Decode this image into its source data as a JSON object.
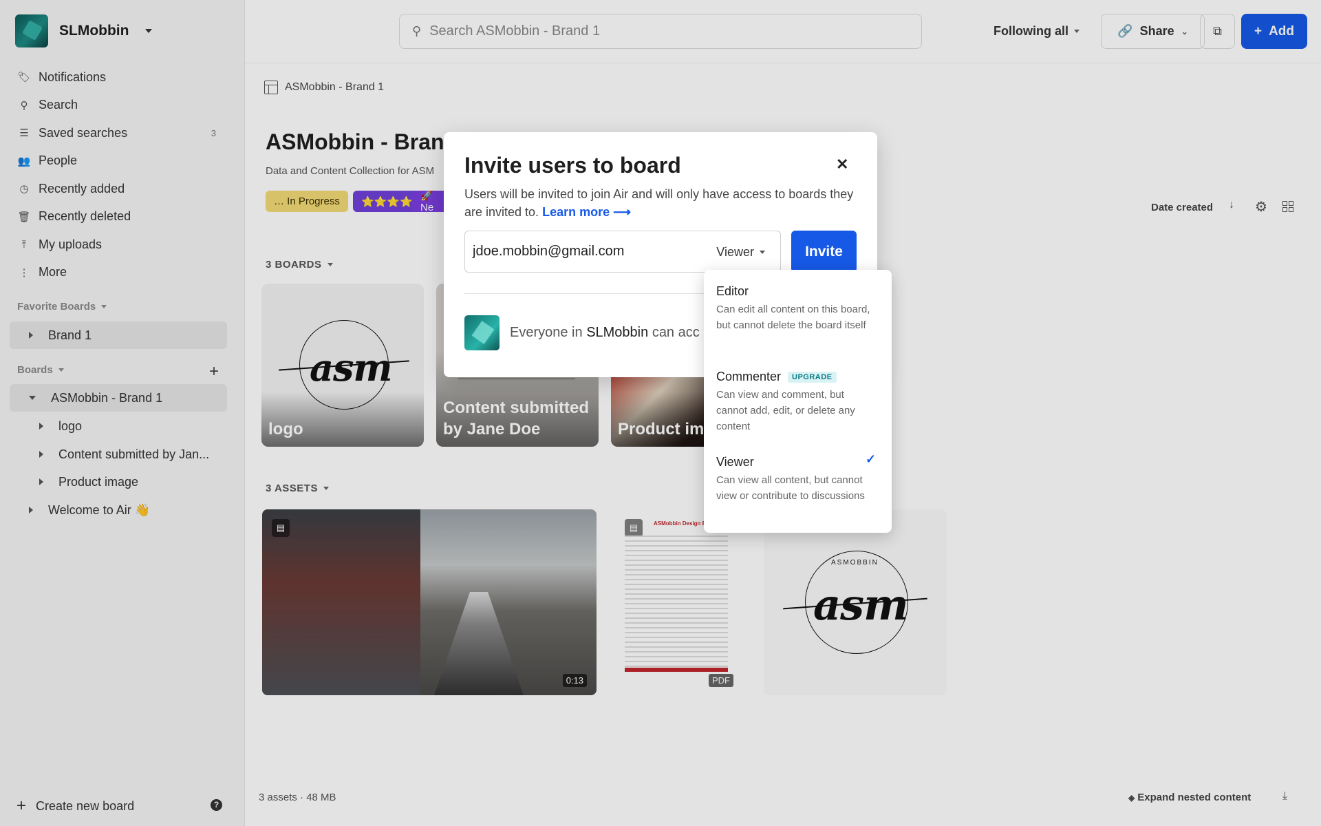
{
  "workspace": {
    "name": "SLMobbin"
  },
  "topbar": {
    "search_placeholder": "Search ASMobbin - Brand 1",
    "following_label": "Following all",
    "share_label": "Share",
    "add_label": "Add"
  },
  "sidebar": {
    "nav": [
      {
        "label": "Notifications",
        "icon": "bell-icon"
      },
      {
        "label": "Search",
        "icon": "search-icon"
      },
      {
        "label": "Saved searches",
        "icon": "saved-searches-icon",
        "count": "3"
      },
      {
        "label": "People",
        "icon": "people-icon"
      },
      {
        "label": "Recently added",
        "icon": "clock-icon"
      },
      {
        "label": "Recently deleted",
        "icon": "trash-icon"
      },
      {
        "label": "My uploads",
        "icon": "upload-icon"
      },
      {
        "label": "More",
        "icon": "more-icon"
      }
    ],
    "favorites_label": "Favorite Boards",
    "favorites": [
      "Brand 1"
    ],
    "boards_label": "Boards",
    "boards": [
      "ASMobbin - Brand 1",
      "logo",
      "Content submitted by Jan...",
      "Product image",
      "Welcome to Air 👋"
    ],
    "create_label": "Create new board"
  },
  "main": {
    "breadcrumb": "ASMobbin - Brand 1",
    "title": "ASMobbin - Brand",
    "description": "Data and Content Collection for ASM",
    "tags": [
      "… In Progress",
      "⭐⭐⭐⭐",
      "🚀 Ne"
    ],
    "sort_label": "Date created",
    "boards_section": "3 BOARDS",
    "board_cards": [
      "logo",
      "Content submitted by Jane Doe",
      "Product ima"
    ],
    "assets_section": "3 ASSETS",
    "video_duration": "0:13",
    "pdf_badge": "PDF",
    "footer_count": "3 assets · 48 MB",
    "expand_label": "Expand nested content",
    "logo_text": "asm",
    "logo_ring_text": "ASMOBBIN",
    "pdf_title": "ASMobbin Design Bri"
  },
  "modal": {
    "title": "Invite users to board",
    "description": "Users will be invited to join Air and will only have access to boards they are invited to.",
    "learn_more": "Learn more ⟶",
    "email_value": "jdoe.mobbin@gmail.com",
    "role_selected": "Viewer",
    "invite_label": "Invite",
    "everyone_prefix": "Everyone in",
    "everyone_workspace": "SLMobbin",
    "everyone_suffix": "can acc"
  },
  "role_dropdown": {
    "options": [
      {
        "title": "Editor",
        "desc": "Can edit all content on this board, but cannot delete the board itself"
      },
      {
        "title": "Commenter",
        "badge": "UPGRADE",
        "desc": "Can view and comment, but cannot add, edit, or delete any content"
      },
      {
        "title": "Viewer",
        "desc": "Can view all content, but cannot view or contribute to discussions",
        "selected": true
      }
    ]
  },
  "colors": {
    "accent": "#1659e6",
    "workspace_logo": "#1f8a83"
  }
}
